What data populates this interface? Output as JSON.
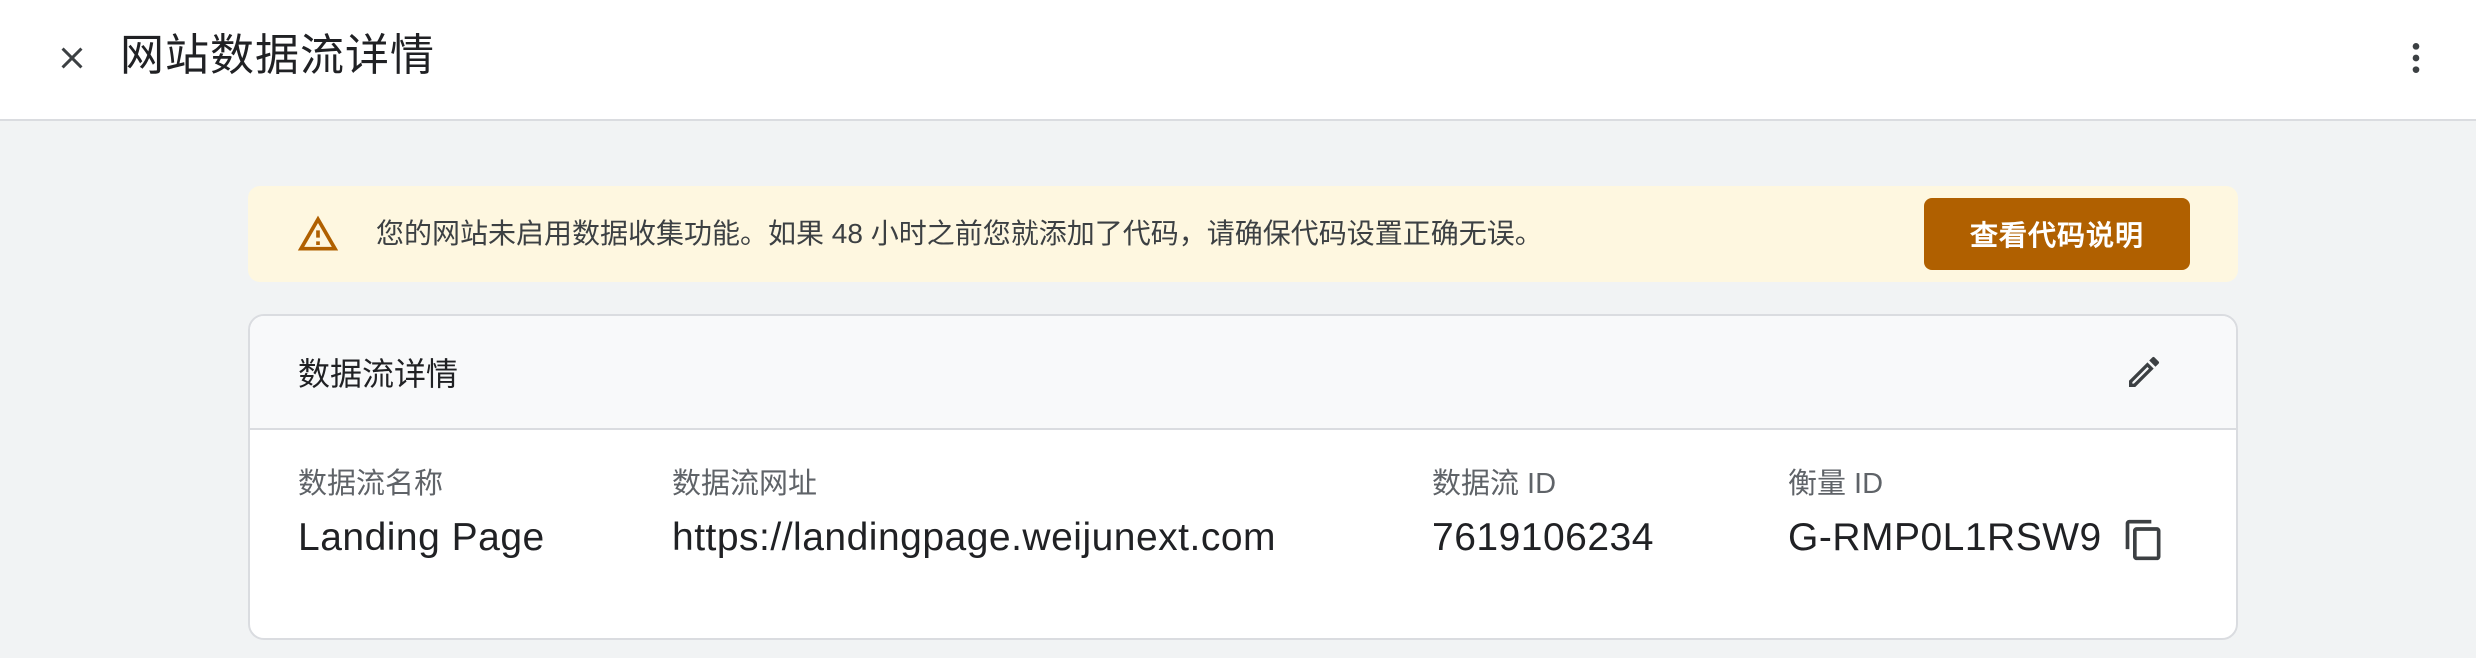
{
  "header": {
    "title": "网站数据流详情",
    "close_icon": "close-icon",
    "more_icon": "more-vert-icon"
  },
  "alert": {
    "icon": "warning-icon",
    "message": "您的网站未启用数据收集功能。如果 48 小时之前您就添加了代码，请确保代码设置正确无误。",
    "button_label": "查看代码说明",
    "colors": {
      "background": "#fef7e0",
      "accent": "#b06000"
    }
  },
  "details": {
    "title": "数据流详情",
    "edit_icon": "edit-icon",
    "fields": [
      {
        "label": "数据流名称",
        "value": "Landing Page"
      },
      {
        "label": "数据流网址",
        "value": "https://landingpage.weijunext.com"
      },
      {
        "label": "数据流 ID",
        "value": "7619106234"
      },
      {
        "label": "衡量 ID",
        "value": "G-RMP0L1RSW9"
      }
    ],
    "copy_icon": "copy-icon"
  }
}
